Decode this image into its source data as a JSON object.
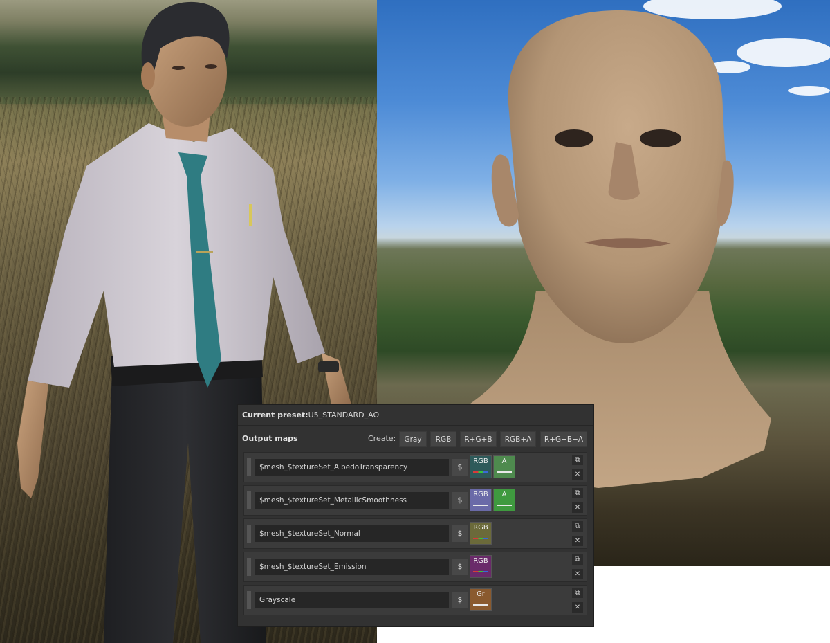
{
  "panel": {
    "preset_label": "Current preset:",
    "preset_value": "U5_STANDARD_AO",
    "title": "Output maps",
    "create_label": "Create:",
    "create_buttons": [
      "Gray",
      "RGB",
      "R+G+B",
      "RGB+A",
      "R+G+B+A"
    ],
    "rows": [
      {
        "name": "$mesh_$textureSet_AlbedoTransparency",
        "dollar": "$",
        "chips": [
          {
            "label": "RGB",
            "bg": "#2e5a5a",
            "bar": "tri"
          },
          {
            "label": "A",
            "bg": "#4e8a4e",
            "bar": "white"
          }
        ]
      },
      {
        "name": "$mesh_$textureSet_MetallicSmoothness",
        "dollar": "$",
        "chips": [
          {
            "label": "RGB",
            "bg": "#6a6aa8",
            "bar": "white"
          },
          {
            "label": "A",
            "bg": "#3f9a3f",
            "bar": "white"
          }
        ]
      },
      {
        "name": "$mesh_$textureSet_Normal",
        "dollar": "$",
        "chips": [
          {
            "label": "RGB",
            "bg": "#6b6a3a",
            "bar": "tri"
          }
        ]
      },
      {
        "name": "$mesh_$textureSet_Emission",
        "dollar": "$",
        "chips": [
          {
            "label": "RGB",
            "bg": "#6a2a6a",
            "bar": "tri"
          }
        ]
      },
      {
        "name": "Grayscale",
        "dollar": "$",
        "chips": [
          {
            "label": "Gr",
            "bg": "#8a5a2e",
            "bar": "white"
          }
        ]
      }
    ],
    "copy_icon": "copy-icon",
    "delete_icon": "close-icon",
    "delete_glyph": "✕",
    "copy_glyph": "⧉"
  },
  "colors": {
    "panel_bg": "#323232",
    "row_bg": "#3b3b3b",
    "input_bg": "#262626",
    "button_bg": "#454545"
  }
}
